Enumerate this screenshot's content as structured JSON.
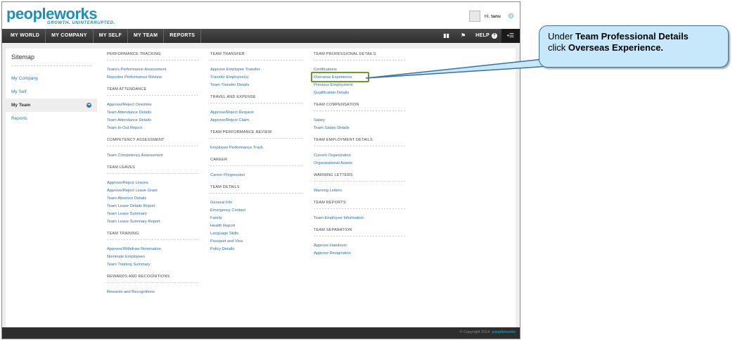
{
  "header": {
    "logo_text": "peopleworks",
    "logo_tagline": "GROWTH. UNINTERRUPTED.",
    "greeting": "Hi,",
    "user_name": "tanu"
  },
  "nav": {
    "items": [
      "MY WORLD",
      "MY COMPANY",
      "MY SELF",
      "MY TEAM",
      "REPORTS"
    ],
    "help_label": "HELP",
    "help_icon": "?"
  },
  "sidebar": {
    "title": "Sitemap",
    "items": [
      {
        "label": "My Company"
      },
      {
        "label": "My Self"
      },
      {
        "label": "My Team"
      },
      {
        "label": "Reports"
      }
    ]
  },
  "columns": [
    {
      "sections": [
        {
          "title": "PERFORMANCE TRACKING",
          "links": [
            "Team's Performance Assessment",
            "Reportee Performance Review"
          ]
        },
        {
          "title": "TEAM ATTENDANCE",
          "links": [
            "Approve/Reject Overtime",
            "Team Attendance Details",
            "Team Attendance Details",
            "Team In-Out Report"
          ]
        },
        {
          "title": "COMPETENCY ASSESSMENT",
          "links": [
            "Team Competency Assessment"
          ]
        },
        {
          "title": "TEAM LEAVES",
          "links": [
            "Approve/Reject Leaves",
            "Approve/Reject Leave Grant",
            "Team Absence Details",
            "Team Leave Details Report",
            "Team Leave Summary",
            "Team Leave Summary Report"
          ]
        },
        {
          "title": "TEAM TRAINING",
          "links": [
            "Approve/Withdraw Nomination",
            "Nominate Employees",
            "Team Training Summary"
          ]
        },
        {
          "title": "REWARDS AND RECOGNITIONS",
          "links": [
            "Rewards and Recognitions"
          ]
        }
      ]
    },
    {
      "sections": [
        {
          "title": "TEAM TRANSFER",
          "links": [
            "Approve Employee Transfer",
            "Transfer Employee(s)",
            "Team Transfer Details"
          ]
        },
        {
          "title": "TRAVEL AND EXPENSE",
          "links": [
            "Approve/Reject Request",
            "Approve/Reject Claim"
          ]
        },
        {
          "title": "TEAM PERFORMANCE REVIEW",
          "links": [
            "Employee Performance Track"
          ]
        },
        {
          "title": "CAREER",
          "links": [
            "Career Progression"
          ]
        },
        {
          "title": "TEAM DETAILS",
          "links": [
            "General Info",
            "Emergency Contact",
            "Family",
            "Health Report",
            "Language Skills",
            "Passport and Visa",
            "Policy Details"
          ]
        }
      ]
    },
    {
      "sections": [
        {
          "title": "TEAM PROFESSIONAL DETAILS",
          "links": [
            "Certifications",
            "Overseas Experience",
            "Previous Employment",
            "Qualification Details"
          ]
        },
        {
          "title": "TEAM COMPENSATION",
          "links": [
            "Salary",
            "Team Salary Details"
          ]
        },
        {
          "title": "TEAM EMPLOYMENT DETAILS",
          "links": [
            "Current Organization",
            "Organizational Assets"
          ]
        },
        {
          "title": "WARNING LETTERS",
          "links": [
            "Warning Letters"
          ]
        },
        {
          "title": "TEAM REPORTS",
          "links": [
            "Team Employee Information"
          ]
        },
        {
          "title": "TEAM SEPARATION",
          "links": [
            "Approve Handover",
            "Approve Resignation"
          ]
        }
      ]
    }
  ],
  "footer": {
    "copyright": "© Copyright 2014",
    "brand": "peopleworks"
  },
  "callout": {
    "line1_prefix": "Under ",
    "line1_bold": "Team Professional Details",
    "line2_prefix": "click ",
    "line2_bold": "Overseas Experience."
  },
  "colors": {
    "brand": "#1f8fb4",
    "link": "#2a6fb0",
    "highlight": "#6b9a2a",
    "callout_bg": "#c6e8fa"
  }
}
